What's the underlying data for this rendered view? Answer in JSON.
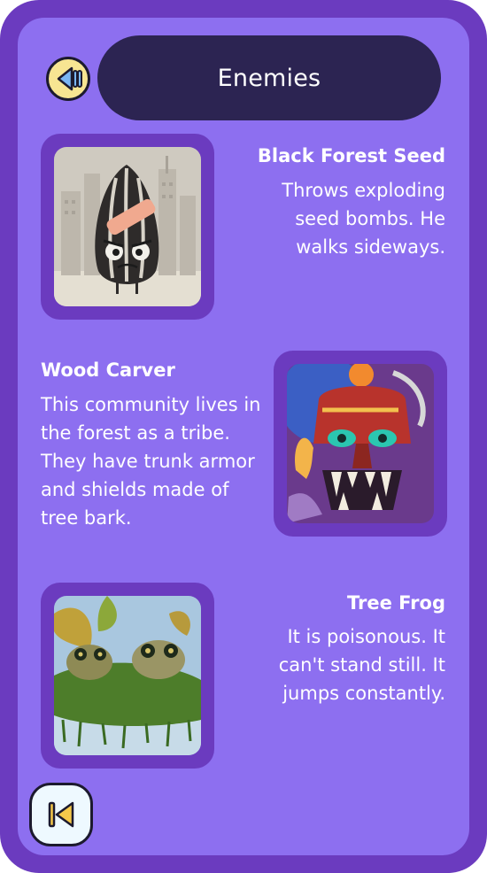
{
  "header": {
    "title": "Enemies"
  },
  "controls": {
    "sound_icon": "speaker-icon",
    "back_icon": "skip-back-icon"
  },
  "enemies": [
    {
      "name": "Black Forest Seed",
      "description_lines": [
        "Throws exploding",
        "seed bombs. He",
        "walks sideways."
      ],
      "art": "sunflower-seed-character-art"
    },
    {
      "name": "Wood Carver",
      "description_lines": [
        "This community lives in",
        "the forest as a tribe.",
        "They have trunk armor",
        "and shields made of",
        "tree bark."
      ],
      "art": "tiki-mask-warrior-art"
    },
    {
      "name": "Tree Frog",
      "description_lines": [
        "It is poisonous. It",
        "can't stand still. It",
        "jumps constantly."
      ],
      "art": "frogs-in-moss-art"
    }
  ],
  "colors": {
    "frame": "#6b3bbf",
    "panel": "#8d6ff0",
    "title_pill": "#2c2452",
    "sound_button": "#f7e592",
    "back_button": "#eef9ff"
  }
}
